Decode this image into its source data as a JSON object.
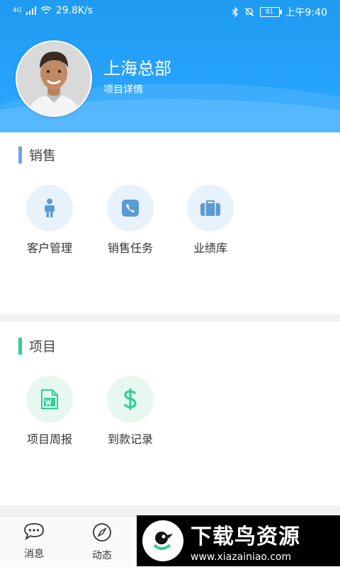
{
  "status_bar": {
    "network": "4G",
    "speed": "29.8K/s",
    "battery": "81",
    "time": "上午9:40"
  },
  "header": {
    "title": "上海总部",
    "subtitle": "项目详情"
  },
  "sections": [
    {
      "title": "销售",
      "accent": "#6ea3e6",
      "items": [
        {
          "label": "客户管理",
          "icon": "person-icon"
        },
        {
          "label": "销售任务",
          "icon": "phone-icon"
        },
        {
          "label": "业绩库",
          "icon": "briefcase-icon"
        }
      ]
    },
    {
      "title": "项目",
      "accent": "#2ecf93",
      "items": [
        {
          "label": "项目周报",
          "icon": "word-document-icon"
        },
        {
          "label": "到款记录",
          "icon": "dollar-icon"
        }
      ]
    }
  ],
  "bottom_nav": [
    {
      "label": "消息",
      "icon": "chat-bubble-icon"
    },
    {
      "label": "动态",
      "icon": "compass-icon"
    }
  ],
  "watermark": {
    "main": "下载鸟资源",
    "url": "www.xiazainiao.com"
  },
  "colors": {
    "header_blue": "#2aa7ff",
    "sales_icon_bg": "#e8f2fb",
    "sales_icon": "#5b9bd5",
    "project_icon_bg": "#e6f8ef",
    "project_icon": "#2ecf93"
  }
}
